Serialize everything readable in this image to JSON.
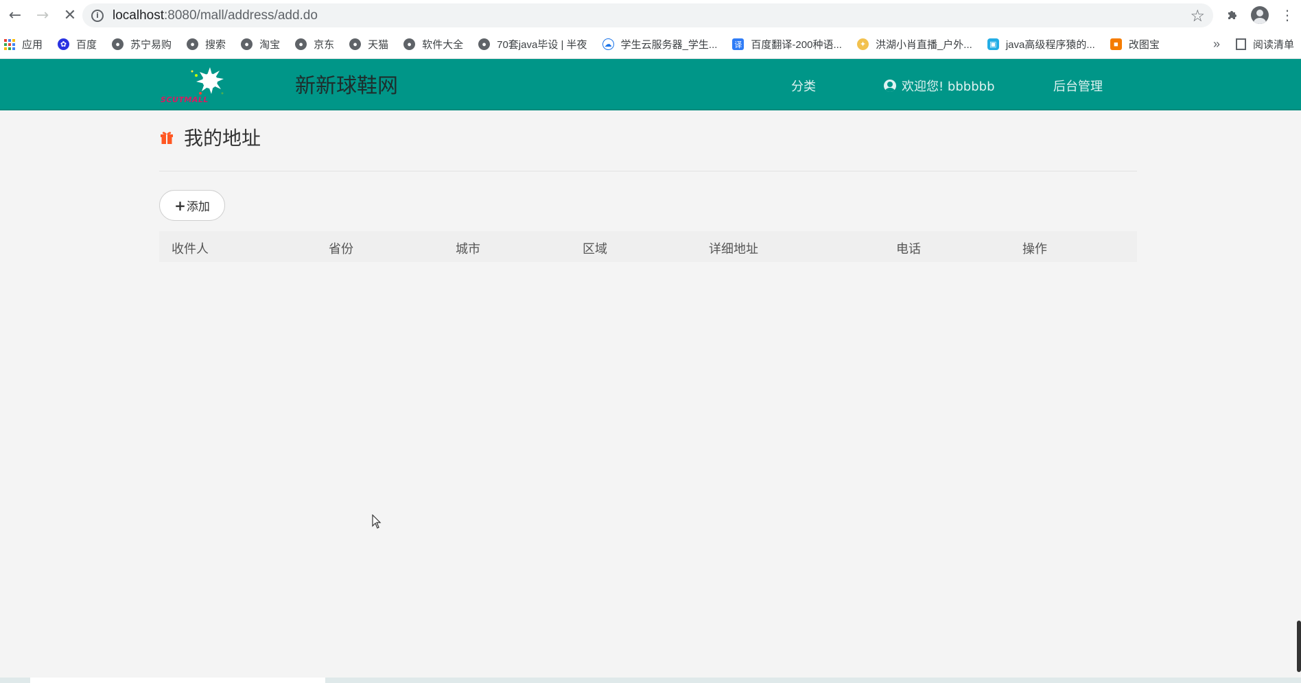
{
  "browser": {
    "url_host": "localhost",
    "url_path": ":8080/mall/address/add.do",
    "bookmarks": [
      {
        "label": "应用",
        "icon": "apps-grid-icon"
      },
      {
        "label": "百度",
        "icon": "baidu-paw-icon"
      },
      {
        "label": "苏宁易购",
        "icon": "globe-icon"
      },
      {
        "label": "搜索",
        "icon": "globe-icon"
      },
      {
        "label": "淘宝",
        "icon": "globe-icon"
      },
      {
        "label": "京东",
        "icon": "globe-icon"
      },
      {
        "label": "天猫",
        "icon": "globe-icon"
      },
      {
        "label": "软件大全",
        "icon": "globe-icon"
      },
      {
        "label": "70套java毕设 | 半夜",
        "icon": "globe-icon"
      },
      {
        "label": "学生云服务器_学生...",
        "icon": "cloud-icon"
      },
      {
        "label": "百度翻译-200种语...",
        "icon": "translate-icon"
      },
      {
        "label": "洪湖小肖直播_户外...",
        "icon": "bird-icon"
      },
      {
        "label": "java高级程序猿的...",
        "icon": "bilibili-icon"
      },
      {
        "label": "改图宝",
        "icon": "image-icon"
      }
    ],
    "more": "»",
    "reading_list": "阅读清单"
  },
  "header": {
    "logo_text": "SCUTMALL",
    "title": "新新球鞋网",
    "nav": {
      "category": "分类",
      "welcome": "欢迎您! bbbbbb",
      "admin": "后台管理"
    }
  },
  "main": {
    "section_title": "我的地址",
    "add_button": "添加",
    "table": {
      "columns": [
        "收件人",
        "省份",
        "城市",
        "区域",
        "详细地址",
        "电话",
        "操作"
      ],
      "rows": []
    }
  },
  "colors": {
    "header_bg": "#009688",
    "page_bg": "#f4f4f4",
    "gift_icon": "#ff5722"
  }
}
